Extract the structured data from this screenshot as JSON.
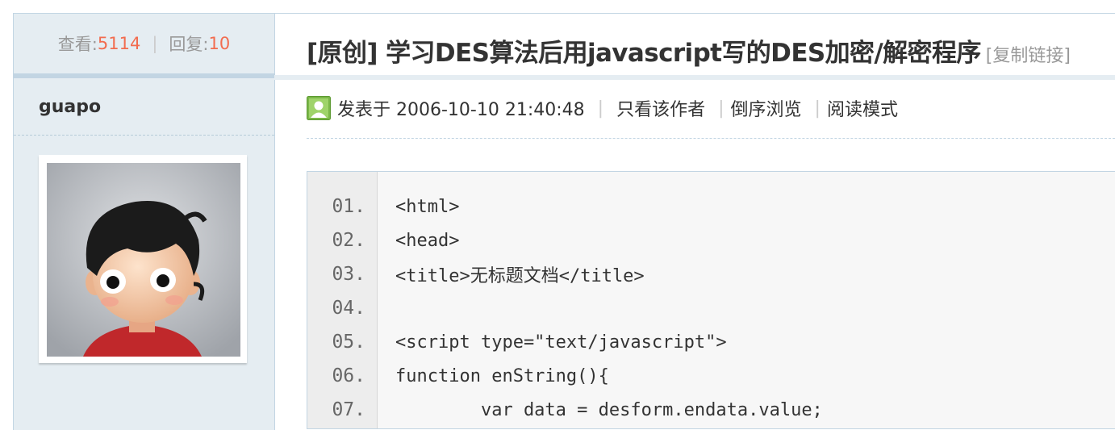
{
  "sidebar": {
    "views_label": "查看:",
    "views_count": "5114",
    "replies_label": "回复:",
    "replies_count": "10",
    "author_name": "guapo"
  },
  "post": {
    "title": "[原创] 学习DES算法后用javascript写的DES加密/解密程序",
    "copy_link_label": "[复制链接]",
    "posted_label": "发表于 2006-10-10 21:40:48",
    "only_author_label": "只看该作者",
    "reverse_order_label": "倒序浏览",
    "reading_mode_label": "阅读模式",
    "user_icon": "user-icon"
  },
  "code_block": {
    "lines": [
      {
        "num": "01.",
        "text": "<html>"
      },
      {
        "num": "02.",
        "text": "<head>"
      },
      {
        "num": "03.",
        "text": "<title>无标题文档</title>"
      },
      {
        "num": "04.",
        "text": ""
      },
      {
        "num": "05.",
        "text": "<script type=\"text/javascript\">"
      },
      {
        "num": "06.",
        "text": "function enString(){"
      },
      {
        "num": "07.",
        "text": "        var data = desform.endata.value;"
      }
    ]
  },
  "colors": {
    "accent_number": "#f26c4f",
    "sidebar_bg": "#e5edf2",
    "border": "#c2d5e3",
    "code_bg": "#f7f7f7"
  }
}
